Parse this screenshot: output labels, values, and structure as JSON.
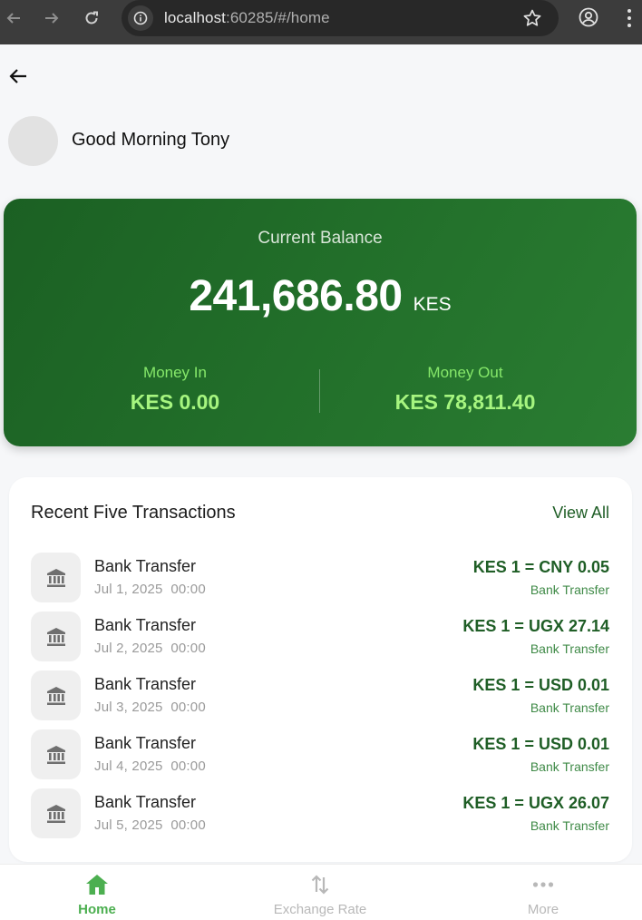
{
  "browser": {
    "url_host": "localhost",
    "url_rest": ":60285/#/home",
    "icons": [
      "arrow-back-icon",
      "arrow-forward-icon",
      "reload-icon",
      "site-info-icon",
      "star-icon",
      "profile-icon",
      "kebab-menu-icon"
    ]
  },
  "header": {
    "greeting": "Good Morning Tony"
  },
  "balance": {
    "label": "Current Balance",
    "amount": "241,686.80",
    "currency": "KES",
    "money_in_label": "Money In",
    "money_in_value": "KES 0.00",
    "money_out_label": "Money Out",
    "money_out_value": "KES 78,811.40",
    "colors": {
      "card_start": "#1b6023",
      "card_end": "#2a7d32",
      "accent": "#a6f57f"
    }
  },
  "transactions": {
    "title": "Recent Five Transactions",
    "view_all": "View All",
    "items": [
      {
        "name": "Bank Transfer",
        "date": "Jul 1, 2025  00:00",
        "rate": "KES 1 = CNY 0.05",
        "type": "Bank Transfer"
      },
      {
        "name": "Bank Transfer",
        "date": "Jul 2, 2025  00:00",
        "rate": "KES 1 = UGX 27.14",
        "type": "Bank Transfer"
      },
      {
        "name": "Bank Transfer",
        "date": "Jul 3, 2025  00:00",
        "rate": "KES 1 = USD 0.01",
        "type": "Bank Transfer"
      },
      {
        "name": "Bank Transfer",
        "date": "Jul 4, 2025  00:00",
        "rate": "KES 1 = USD 0.01",
        "type": "Bank Transfer"
      },
      {
        "name": "Bank Transfer",
        "date": "Jul 5, 2025  00:00",
        "rate": "KES 1 = UGX 26.07",
        "type": "Bank Transfer"
      }
    ]
  },
  "bottom_nav": {
    "items": [
      {
        "label": "Home",
        "icon": "home-icon",
        "active": true
      },
      {
        "label": "Exchange Rate",
        "icon": "swap-vertical-icon",
        "active": false
      },
      {
        "label": "More",
        "icon": "more-horizontal-icon",
        "active": false
      }
    ],
    "active_color": "#4caf50"
  }
}
